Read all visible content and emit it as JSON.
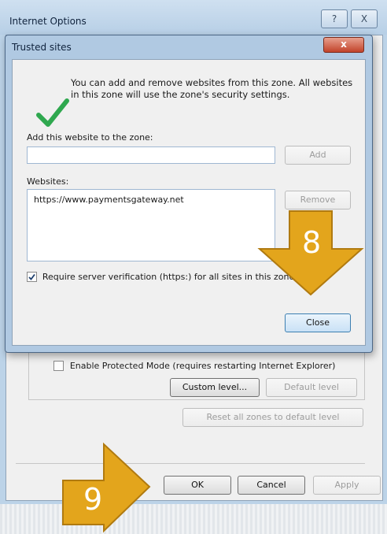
{
  "outer_window": {
    "title": "Internet Options",
    "help_button": "?",
    "close_button": "X",
    "protected_mode_label": "Enable Protected Mode (requires restarting Internet Explorer)",
    "custom_level_label": "Custom level...",
    "default_level_label": "Default level",
    "reset_zones_label": "Reset all zones to default level",
    "ok_label": "OK",
    "cancel_label": "Cancel",
    "apply_label": "Apply"
  },
  "dialog": {
    "title": "Trusted sites",
    "close_x": "x",
    "info_text": "You can add and remove websites from this zone. All websites in this zone will use the zone's security settings.",
    "add_label": "Add this website to the zone:",
    "add_input_value": "",
    "add_button": "Add",
    "websites_label": "Websites:",
    "websites": [
      "https://www.paymentsgateway.net"
    ],
    "remove_button": "Remove",
    "require_https_label": "Require server verification (https:) for all sites in this zone",
    "require_https_checked": true,
    "close_button": "Close"
  },
  "callouts": [
    {
      "number": "8",
      "color": "#e3a51c"
    },
    {
      "number": "9",
      "color": "#e3a51c"
    }
  ],
  "colors": {
    "callout": "#e3a51c",
    "title_bar": "#bcd3e8",
    "close_red": "#c2432a"
  }
}
